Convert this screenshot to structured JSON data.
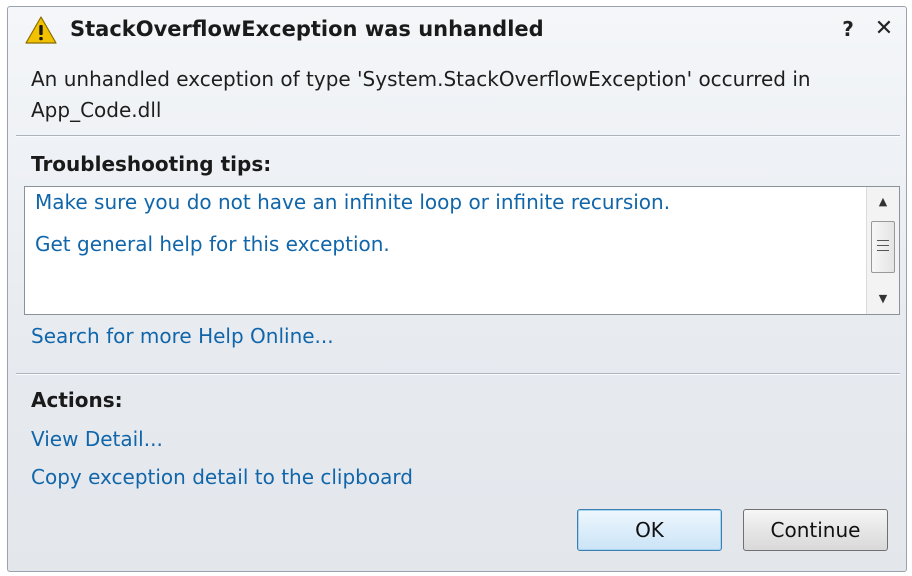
{
  "dialog": {
    "title": "StackOverflowException was unhandled",
    "help_label": "?",
    "close_label": "✕",
    "message": "An unhandled exception of type 'System.StackOverflowException' occurred in App_Code.dll"
  },
  "troubleshooting": {
    "heading": "Troubleshooting tips:",
    "tips": [
      "Make sure you do not have an infinite loop or infinite recursion.",
      "Get general help for this exception."
    ],
    "scroll_up": "▲",
    "scroll_down": "▼",
    "search_link": "Search for more Help Online..."
  },
  "actions": {
    "heading": "Actions:",
    "items": [
      "View Detail...",
      "Copy exception detail to the clipboard"
    ]
  },
  "buttons": {
    "ok_label": "OK",
    "continue_label": "Continue"
  },
  "colors": {
    "link": "#1166aa",
    "warning": "#f2c200"
  },
  "icons": {
    "title": "warning-icon",
    "close": "close-icon",
    "help": "help-icon"
  }
}
